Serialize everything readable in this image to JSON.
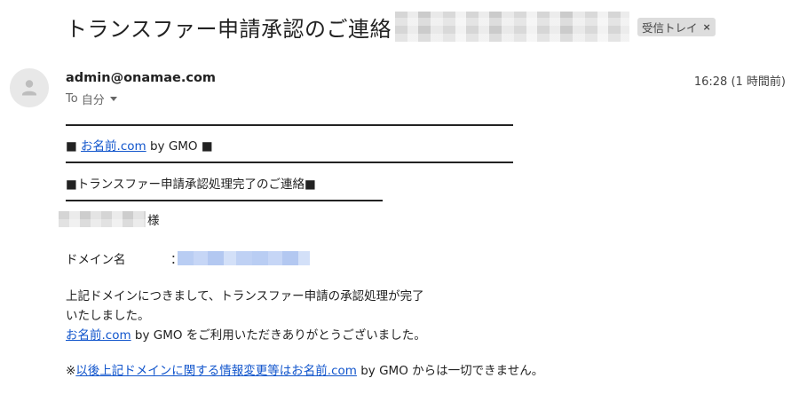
{
  "subject": {
    "title": "トランスファー申請承認のご連絡",
    "label": "受信トレイ",
    "label_close": "×"
  },
  "sender": {
    "email": "admin@onamae.com",
    "to_prefix": "To",
    "to_value": "自分",
    "time": "16:28 (1 時間前)"
  },
  "body": {
    "brand_prefix": "■ ",
    "brand_link": "お名前.com",
    "brand_suffix": " by GMO ■",
    "heading": "■トランスファー申請承認処理完了のご連絡■",
    "recipient_suffix": "様",
    "domain_label": "ドメイン名",
    "domain_colon": "：",
    "message_line1": "上記ドメインにつきまして、トランスファー申請の承認処理が完了",
    "message_line2": "いたしました。",
    "message_line3_link": "お名前.com",
    "message_line3_rest": " by GMO をご利用いただきありがとうございました。",
    "note_prefix": "※",
    "note_link": "以後上記ドメインに関する情報変更等はお名前.com",
    "note_rest": " by GMO からは一切できません。"
  },
  "icons": {
    "avatar": "person-avatar-icon",
    "caret": "chevron-down-icon",
    "label_close": "close-icon"
  },
  "colors": {
    "link": "#1155cc",
    "label_bg": "#dddddd",
    "redaction_blue": "#bfd1f4"
  }
}
